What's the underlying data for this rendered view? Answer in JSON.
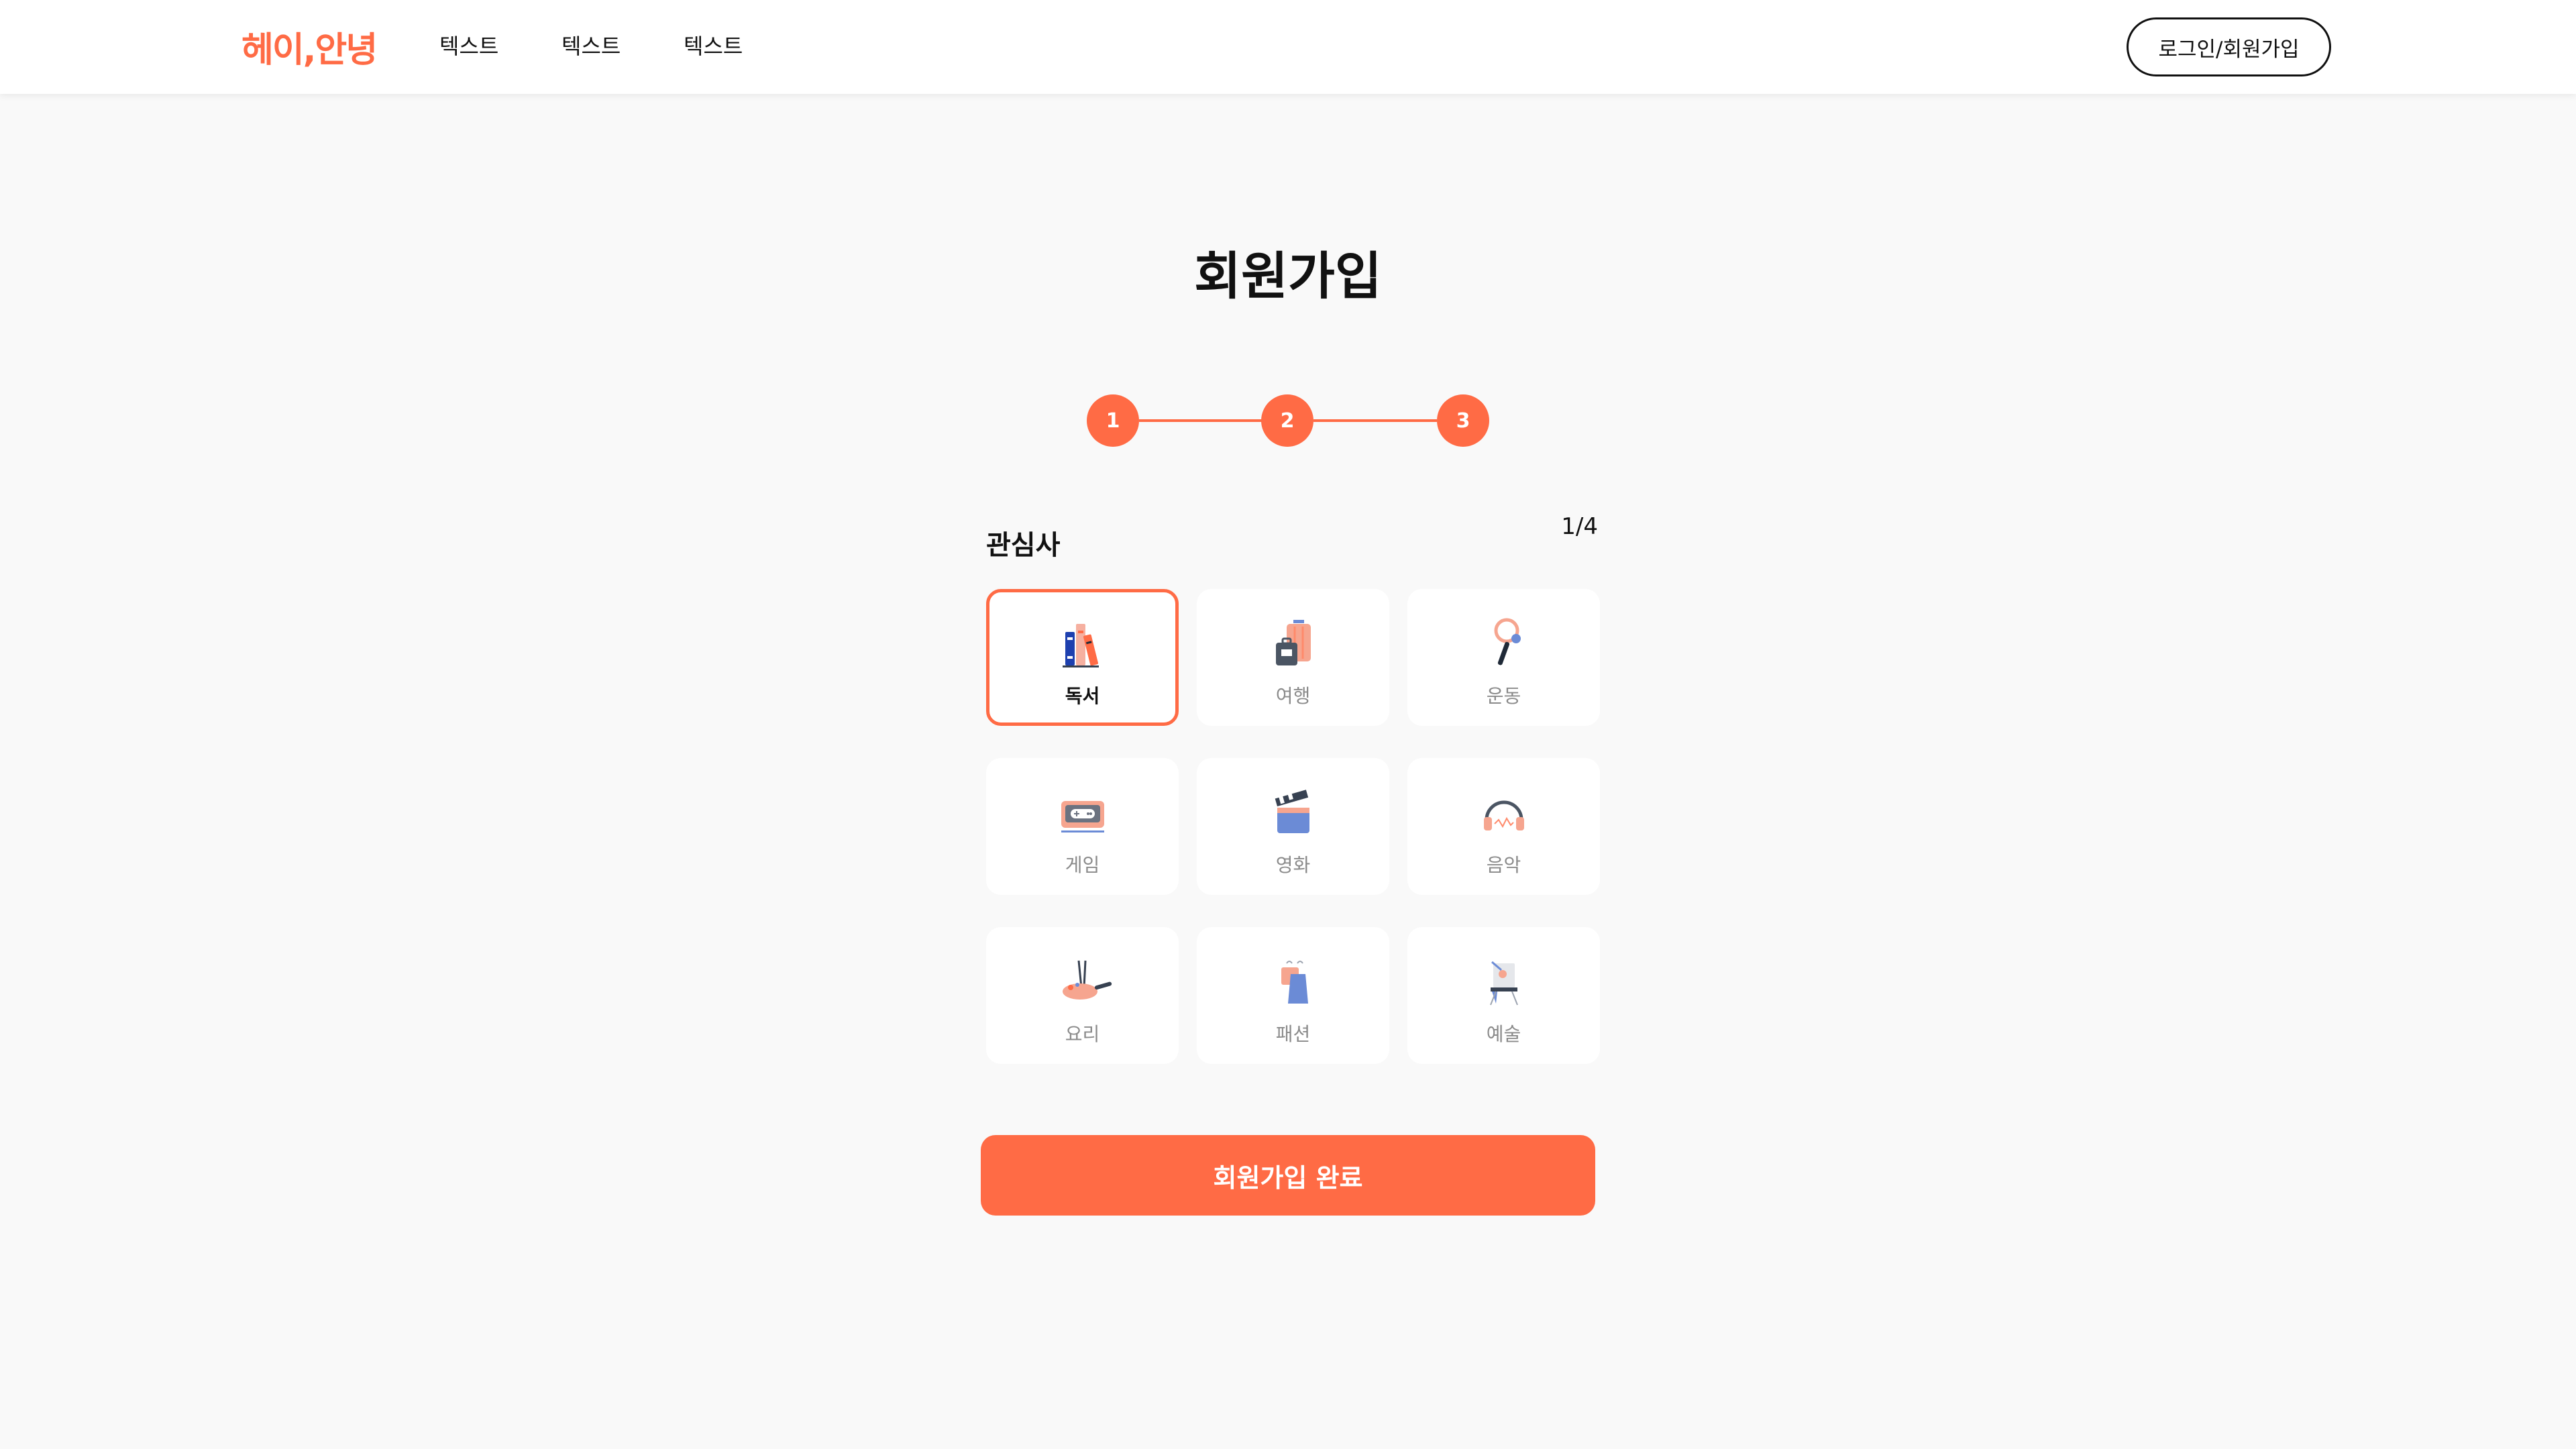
{
  "header": {
    "logo": "헤이,안녕",
    "nav": [
      "텍스트",
      "텍스트",
      "텍스트"
    ],
    "login_label": "로그인/회원가입"
  },
  "page": {
    "title": "회원가입"
  },
  "stepper": {
    "steps": [
      "1",
      "2",
      "3"
    ],
    "color": "#ff6b45"
  },
  "interests": {
    "label": "관심사",
    "counter": "1/4",
    "items": [
      {
        "label": "독서",
        "icon": "books-icon",
        "selected": true
      },
      {
        "label": "여행",
        "icon": "luggage-icon",
        "selected": false
      },
      {
        "label": "운동",
        "icon": "racket-icon",
        "selected": false
      },
      {
        "label": "게임",
        "icon": "game-monitor-icon",
        "selected": false
      },
      {
        "label": "영화",
        "icon": "clapperboard-icon",
        "selected": false
      },
      {
        "label": "음악",
        "icon": "headphones-icon",
        "selected": false
      },
      {
        "label": "요리",
        "icon": "frying-pan-icon",
        "selected": false
      },
      {
        "label": "패션",
        "icon": "clothes-icon",
        "selected": false
      },
      {
        "label": "예술",
        "icon": "easel-icon",
        "selected": false
      }
    ]
  },
  "submit": {
    "label": "회원가입 완료"
  },
  "colors": {
    "accent": "#ff6b45",
    "background": "#f9f9f9"
  }
}
